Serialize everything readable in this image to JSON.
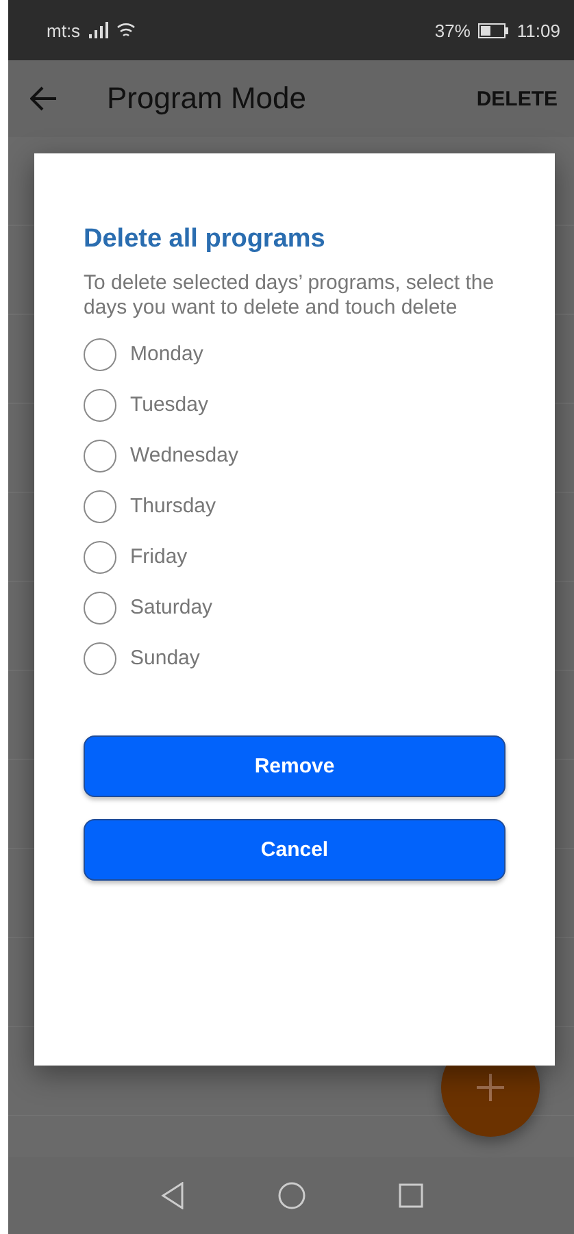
{
  "status_bar": {
    "carrier": "mt:s",
    "battery": "37%",
    "time": "11:09"
  },
  "app_bar": {
    "title": "Program Mode",
    "action": "DELETE"
  },
  "dialog": {
    "title": "Delete all programs",
    "message": "To delete selected days’ programs, select the days you want to delete and touch delete",
    "days": [
      {
        "label": "Monday",
        "selected": false
      },
      {
        "label": "Tuesday",
        "selected": false
      },
      {
        "label": "Wednesday",
        "selected": false
      },
      {
        "label": "Thursday",
        "selected": false
      },
      {
        "label": "Friday",
        "selected": false
      },
      {
        "label": "Saturday",
        "selected": false
      },
      {
        "label": "Sunday",
        "selected": false
      }
    ],
    "buttons": [
      "Remove",
      "Cancel"
    ]
  }
}
